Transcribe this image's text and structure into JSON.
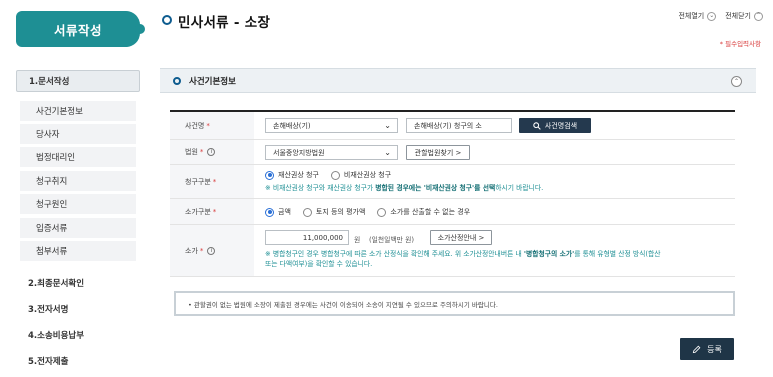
{
  "sidebar": {
    "doc_tab": "서류작성",
    "steps": [
      {
        "label": "1.문서작성"
      },
      {
        "label": "2.최종문서확인"
      },
      {
        "label": "3.전자서명"
      },
      {
        "label": "4.소송비용납부"
      },
      {
        "label": "5.전자제출"
      }
    ],
    "sub_items": [
      "사건기본정보",
      "당사자",
      "법정대리인",
      "청구취지",
      "청구원인",
      "입증서류",
      "첨부서류"
    ]
  },
  "header": {
    "title": "민사서류 - 소장",
    "expand_all": "전체열기",
    "collapse_all": "전체닫기",
    "required_note": "* 필수입력사항"
  },
  "section": {
    "title": "사건기본정보"
  },
  "form": {
    "case_name": {
      "label": "사건명",
      "select_value": "손해배상(기)",
      "input_value": "손해배상(기) 청구의 소",
      "search_button": "사건명검색"
    },
    "court": {
      "label": "법원",
      "select_value": "서울중앙지방법원",
      "find_button": "관할법원찾기 >"
    },
    "claim_type": {
      "label": "청구구분",
      "options": [
        "재산권상 청구",
        "비재산권상 청구"
      ],
      "selected_index": 0,
      "note_parts": [
        "※ 비재산권상 청구와 재산권상 청구가 ",
        "병합된 경우에는 '비재산권상 청구'를 선택",
        "하시기 바랍니다."
      ]
    },
    "value_type": {
      "label": "소가구분",
      "options": [
        "금액",
        "토지 등의 평가액",
        "소가를 산출할 수 없는 경우"
      ],
      "selected_index": 0
    },
    "value": {
      "label": "소가",
      "amount": "11,000,000",
      "unit": "원",
      "amount_words": "(일천일백만 원)",
      "guide_button": "소가산정안내 >",
      "note_parts": [
        "※ 병합청구인 경우 병합청구에 따른 소가 산정식을 확인해 주세요.  위 소가산정안내버튼 내 ",
        "'병합청구의 소가'",
        "를 통해 유형별 산정 방식(합산",
        "또는 다액여부)을 확인할 수 있습니다."
      ]
    }
  },
  "notice": "• 관할권이 없는 법원에 소장이 제출된 경우에는 사건이 이송되어 소송이 지연될 수 있으므로 주의하시기 바랍니다.",
  "register_button": "등록",
  "colors": {
    "accent_teal": "#1e8f94",
    "navy": "#24394e",
    "required_red": "#d83a3a",
    "radio_blue": "#2a6fd6"
  }
}
